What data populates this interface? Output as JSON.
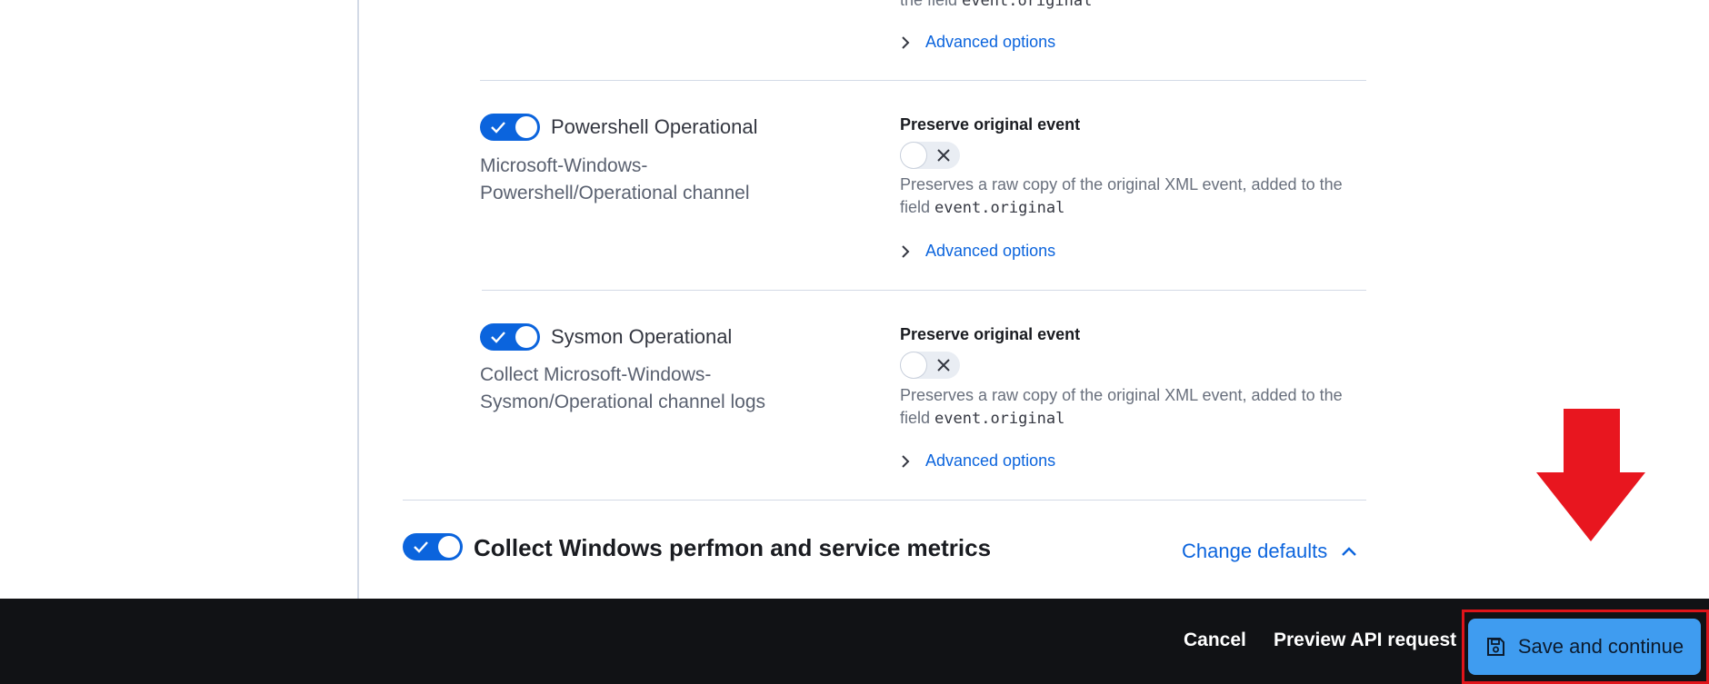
{
  "streams": [
    {
      "title": "Powershell Operational",
      "description": "Microsoft-Windows-Powershell/Operational channel",
      "enabled": true,
      "preserve": {
        "label": "Preserve original event",
        "enabled": false,
        "help_text": "Preserves a raw copy of the original XML event, added to the field ",
        "help_code": "event.original"
      },
      "advanced_label": "Advanced options"
    },
    {
      "title": "Sysmon Operational",
      "description": "Collect Microsoft-Windows-Sysmon/Operational channel logs",
      "enabled": true,
      "preserve": {
        "label": "Preserve original event",
        "enabled": false,
        "help_text": "Preserves a raw copy of the original XML event, added to the field ",
        "help_code": "event.original"
      },
      "advanced_label": "Advanced options"
    }
  ],
  "top_partial": {
    "help_text": "the field ",
    "help_code": "event.original",
    "advanced_label": "Advanced options"
  },
  "section": {
    "title": "Collect Windows perfmon and service metrics",
    "enabled": true,
    "change_defaults_label": "Change defaults"
  },
  "bottom_bar": {
    "cancel_label": "Cancel",
    "preview_label": "Preview API request",
    "save_label": "Save and continue"
  },
  "colors": {
    "accent": "#0b64dd",
    "save_button": "#3f9cf0",
    "bottom_bar": "#111215",
    "highlight": "#e0141a"
  },
  "icons": [
    "check-icon",
    "cross-icon",
    "chevron-right-icon",
    "chevron-up-icon",
    "save-icon",
    "down-arrow-icon"
  ]
}
